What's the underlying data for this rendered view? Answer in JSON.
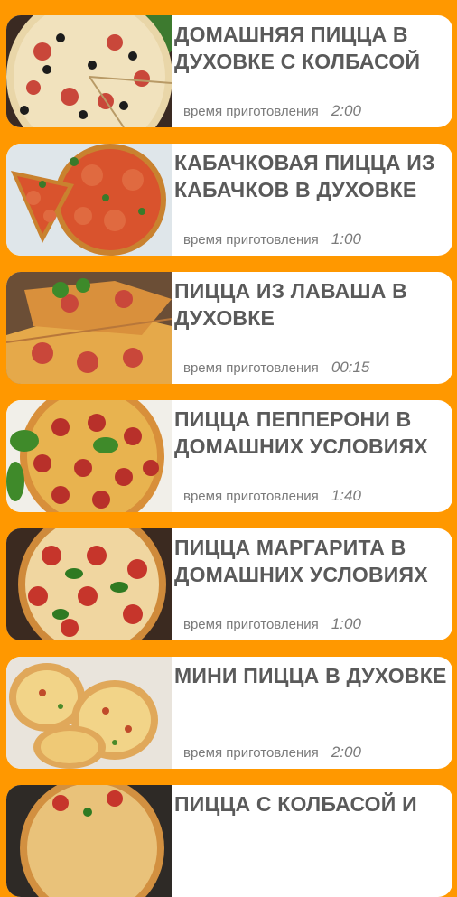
{
  "recipes": [
    {
      "title": "ДОМАШНЯЯ ПИЦЦА В ДУХОВКЕ С КОЛБАСОЙ",
      "time_label": "время приготовления",
      "time": "2:00",
      "image": "pizza-sausage-olives"
    },
    {
      "title": "КАБАЧКОВАЯ ПИЦЦА ИЗ КАБАЧКОВ В ДУХОВКЕ",
      "time_label": "время приготовления",
      "time": "1:00",
      "image": "zucchini-pizza"
    },
    {
      "title": "ПИЦЦА ИЗ ЛАВАША В ДУХОВКЕ",
      "time_label": "время приготовления",
      "time": "00:15",
      "image": "lavash-pizza"
    },
    {
      "title": "ПИЦЦА ПЕППЕРОНИ В ДОМАШНИХ УСЛОВИЯХ",
      "time_label": "время приготовления",
      "time": "1:40",
      "image": "pepperoni-pizza"
    },
    {
      "title": "ПИЦЦА МАРГАРИТА В ДОМАШНИХ УСЛОВИЯХ",
      "time_label": "время приготовления",
      "time": "1:00",
      "image": "margherita-pizza"
    },
    {
      "title": "МИНИ ПИЦЦА В ДУХОВКЕ",
      "time_label": "время приготовления",
      "time": "2:00",
      "image": "mini-pizza"
    },
    {
      "title": "ПИЦЦА С КОЛБАСОЙ И",
      "time_label": "",
      "time": "",
      "image": "pizza-sausage"
    }
  ],
  "colors": {
    "background": "#FF9800",
    "card": "#FFFFFF",
    "title": "#5A5A5A",
    "meta": "#7A7A7A"
  }
}
